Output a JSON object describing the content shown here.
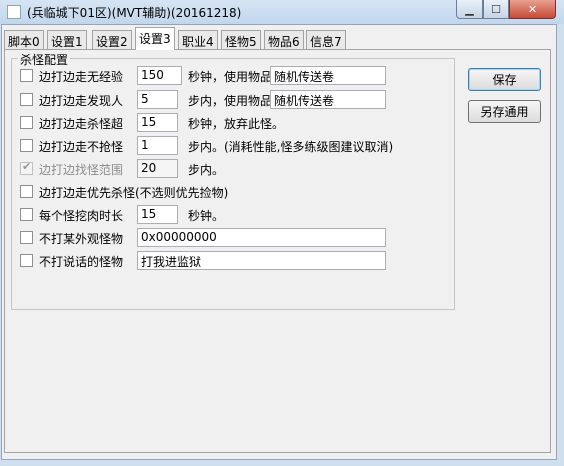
{
  "window": {
    "title": "(兵临城下01区)(MVT辅助)(20161218)"
  },
  "tabs": [
    "脚本0",
    "设置1",
    "设置2",
    "设置3",
    "职业4",
    "怪物5",
    "物品6",
    "信息7"
  ],
  "group": {
    "title": "杀怪配置",
    "rows": [
      {
        "label": "边打边走无经验",
        "value": "150",
        "suffix": "秒钟，使用物品",
        "extra": "随机传送卷"
      },
      {
        "label": "边打边走发现人",
        "value": "5",
        "suffix": "步内，使用物品",
        "extra": "随机传送卷"
      },
      {
        "label": "边打边走杀怪超",
        "value": "15",
        "suffix": "秒钟，放弃此怪。"
      },
      {
        "label": "边打边走不抢怪",
        "value": "1",
        "suffix": "步内。(消耗性能,怪多练级图建议取消)"
      },
      {
        "label": "边打边找怪范围",
        "value": "20",
        "suffix": "步内。"
      },
      {
        "label": "边打边走优先杀怪(不选则优先捡物)"
      },
      {
        "label": "每个怪挖肉时长",
        "value": "15",
        "suffix": "秒钟。"
      },
      {
        "label": "不打某外观怪物",
        "value": "0x00000000"
      },
      {
        "label": "不打说话的怪物",
        "value": "打我进监狱"
      }
    ]
  },
  "buttons": {
    "save": "保存",
    "save_common": "另存通用"
  }
}
